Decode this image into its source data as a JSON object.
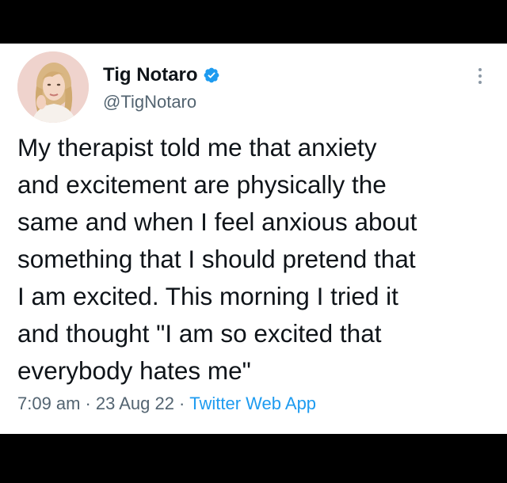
{
  "tweet": {
    "author_name": "Tig Notaro",
    "handle": "@TigNotaro",
    "text_lines": [
      "My therapist told me that anxiety",
      "and excitement are physically the",
      "same and when I feel anxious about",
      "something that I should pretend that",
      "I am excited. This morning I tried it",
      "and thought \"I am so excited that",
      "everybody hates me\""
    ],
    "time": "7:09 am",
    "date": "23 Aug 22",
    "source": "Twitter Web App",
    "separator": "·"
  },
  "icons": {
    "verified": "verified-badge-icon",
    "more": "more-options-icon",
    "avatar": "profile-photo"
  },
  "colors": {
    "verified_blue": "#1d9bf0",
    "text": "#0f1419",
    "secondary_text": "#536471",
    "frame": "#000000"
  }
}
